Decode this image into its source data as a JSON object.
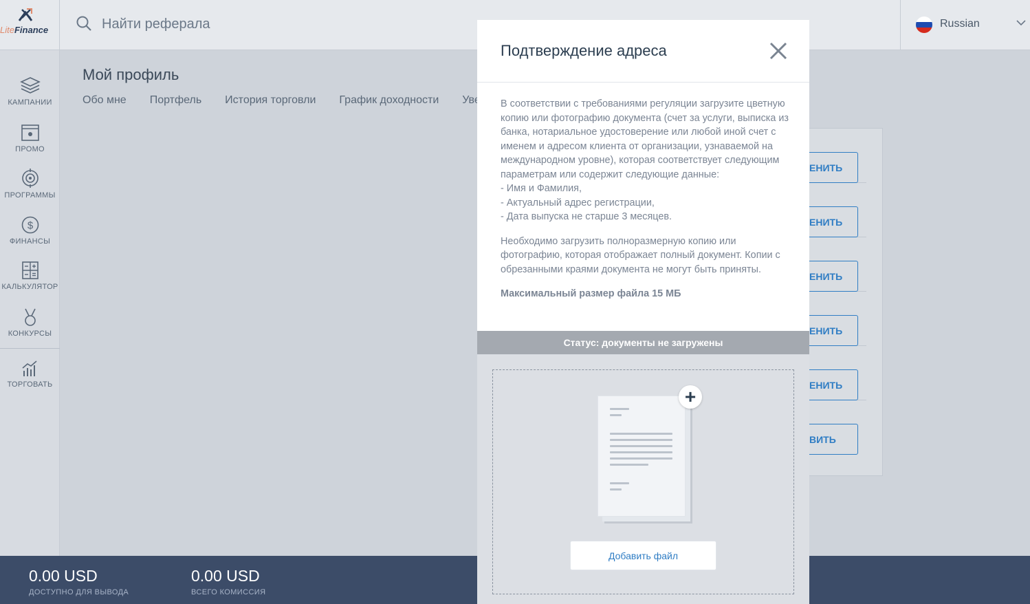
{
  "app": {
    "logo_text": "LiteFinance",
    "logo_text_lite": "Lite",
    "logo_text_finance": "Finance"
  },
  "header": {
    "search_placeholder": "Найти реферала",
    "language": "Russian"
  },
  "sidebar": {
    "items": [
      {
        "label": "КАМПАНИИ",
        "icon": "layers-icon"
      },
      {
        "label": "ПРОМО",
        "icon": "promo-icon"
      },
      {
        "label": "ПРОГРАММЫ",
        "icon": "target-icon"
      },
      {
        "label": "ФИНАНСЫ",
        "icon": "dollar-icon"
      },
      {
        "label": "КАЛЬКУЛЯТОР",
        "icon": "calculator-icon"
      },
      {
        "label": "КОНКУРСЫ",
        "icon": "medal-icon"
      },
      {
        "label": "ТОРГОВАТЬ",
        "icon": "chart-icon"
      }
    ]
  },
  "page": {
    "title": "Мой профиль",
    "tabs": [
      "Обо мне",
      "Портфель",
      "История торговли",
      "График доходности",
      "Уве"
    ]
  },
  "card": {
    "buttons": [
      "ЕНИТЬ",
      "ЕНИТЬ",
      "ЕНИТЬ",
      "ЕНИТЬ",
      "ЕНИТЬ",
      "ВИТЬ"
    ]
  },
  "footer": {
    "available": {
      "value": "0.00 USD",
      "label": "ДОСТУПНО ДЛЯ ВЫВОДА"
    },
    "commission": {
      "value": "0.00 USD",
      "label": "ВСЕГО КОМИССИЯ"
    }
  },
  "modal": {
    "title": "Подтверждение адреса",
    "paragraph1": "В соответствии с требованиями регуляции загрузите цветную копию или фотографию документа (счет за услуги, выписка из банка, нотариальное удостоверение или любой иной счет с именем и адресом клиента от организации, узнаваемой на международном уровне), которая соответствует следующим параметрам или содержит следующие данные:\n- Имя и Фамилия,\n- Актуальный адрес регистрации,\n- Дата выпуска не старше 3 месяцев.",
    "paragraph2": "Необходимо загрузить полноразмерную копию или фотографию, которая отображает полный документ. Копии с обрезанными краями документа не могут быть приняты.",
    "max_size": "Максимальный размер файла 15 МБ",
    "status": "Статус: документы не загружены",
    "add_file": "Добавить файл"
  },
  "colors": {
    "accent": "#2f7dc4",
    "footer_bg": "#3c4c68",
    "status_bg": "#a4a9b0"
  }
}
